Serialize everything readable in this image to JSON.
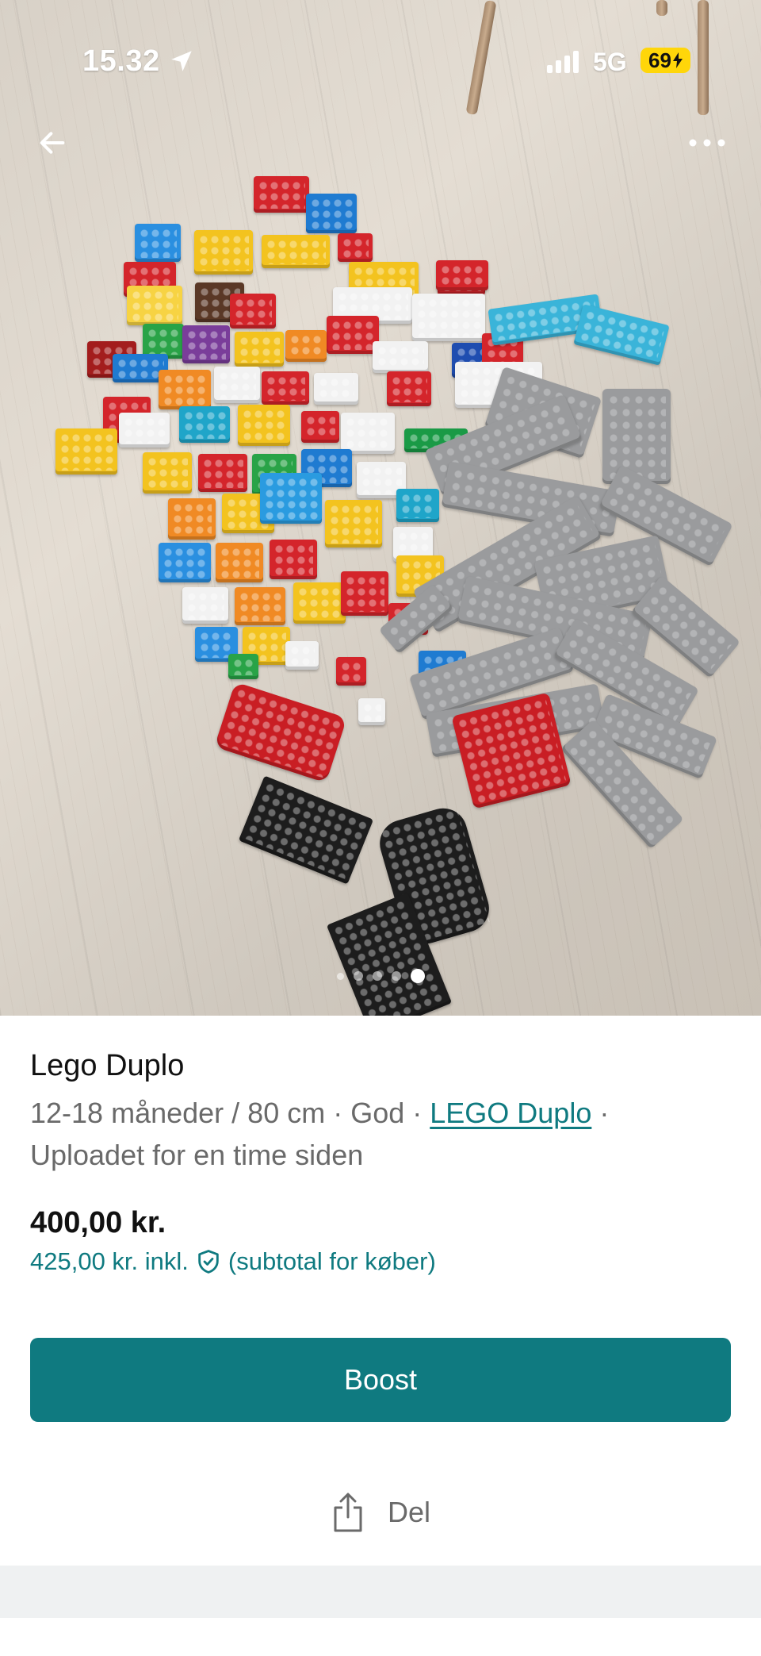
{
  "status_bar": {
    "time": "15.32",
    "network": "5G",
    "battery": "69"
  },
  "photo": {
    "page_count": 5,
    "active_index": 4,
    "icons": [
      "arrow-left-icon",
      "more-horizontal-icon",
      "location-arrow-icon",
      "signal-icon",
      "battery-charging-icon"
    ]
  },
  "listing": {
    "title": "Lego Duplo",
    "meta_size": "12-18 måneder / 80 cm",
    "meta_sep1": " · ",
    "meta_condition": "God",
    "meta_sep2": " · ",
    "meta_brand": "LEGO Duplo",
    "meta_sep3": " ·",
    "uploaded": "Uploadet for en time siden",
    "price": "400,00 kr.",
    "price_incl": "425,00 kr. inkl.",
    "price_incl_note": "(subtotal for køber)"
  },
  "actions": {
    "boost_label": "Boost",
    "share_label": "Del"
  },
  "colors": {
    "accent": "#0f7a80",
    "muted_text": "#6a6a6a",
    "battery": "#ffd60a"
  }
}
